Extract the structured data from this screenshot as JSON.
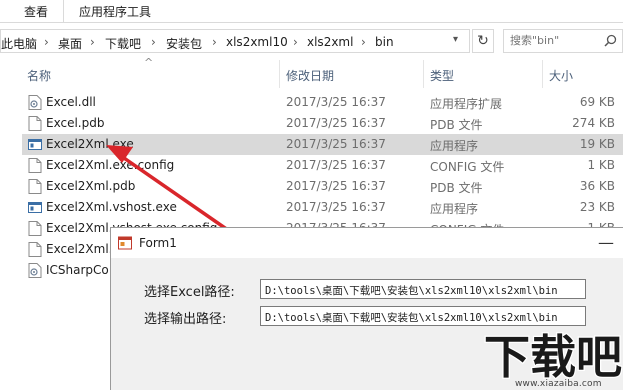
{
  "ribbon": {
    "tabs": [
      "查看",
      "应用程序工具"
    ]
  },
  "address_bar": {
    "breadcrumbs": [
      "此电脑",
      "桌面",
      "下载吧",
      "安装包",
      "xls2xml10",
      "xls2xml",
      "bin"
    ]
  },
  "search": {
    "placeholder": "搜索\"bin\""
  },
  "columns": {
    "name": "名称",
    "date": "修改日期",
    "type": "类型",
    "size": "大小"
  },
  "files": [
    {
      "name": "Excel.dll",
      "date": "2017/3/25 16:37",
      "type": "应用程序扩展",
      "size": "69 KB",
      "icon": "dll-icon"
    },
    {
      "name": "Excel.pdb",
      "date": "2017/3/25 16:37",
      "type": "PDB 文件",
      "size": "274 KB",
      "icon": "file-icon"
    },
    {
      "name": "Excel2Xml.exe",
      "date": "2017/3/25 16:37",
      "type": "应用程序",
      "size": "19 KB",
      "icon": "exe-icon",
      "state": "hover"
    },
    {
      "name": "Excel2Xml.exe.config",
      "date": "2017/3/25 16:37",
      "type": "CONFIG 文件",
      "size": "1 KB",
      "icon": "file-icon"
    },
    {
      "name": "Excel2Xml.pdb",
      "date": "2017/3/25 16:37",
      "type": "PDB 文件",
      "size": "36 KB",
      "icon": "file-icon"
    },
    {
      "name": "Excel2Xml.vshost.exe",
      "date": "2017/3/25 16:37",
      "type": "应用程序",
      "size": "23 KB",
      "icon": "exe-icon"
    },
    {
      "name": "Excel2Xml.vshost.exe.config",
      "date": "2017/3/25 16:37",
      "type": "CONFIG 文件",
      "size": "1 KB",
      "icon": "file-icon"
    },
    {
      "name": "Excel2Xml.",
      "date": "",
      "type": "",
      "size": "",
      "icon": "file-icon"
    },
    {
      "name": "ICSharpCo",
      "date": "",
      "type": "",
      "size": "",
      "icon": "dll-icon"
    }
  ],
  "form1": {
    "title": "Form1",
    "excel_path_label": "选择Excel路径:",
    "excel_path_value": "D:\\tools\\桌面\\下载吧\\安装包\\xls2xml10\\xls2xml\\bin",
    "output_path_label": "选择输出路径:",
    "output_path_value": "D:\\tools\\桌面\\下载吧\\安装包\\xls2xml10\\xls2xml\\bin"
  },
  "watermark": {
    "logo": "下载吧",
    "url": "www.xiazaiba.com"
  },
  "colors": {
    "arrow": "#d9262b",
    "row_hover": "#d9d9d9",
    "column_header": "#4c607a"
  }
}
